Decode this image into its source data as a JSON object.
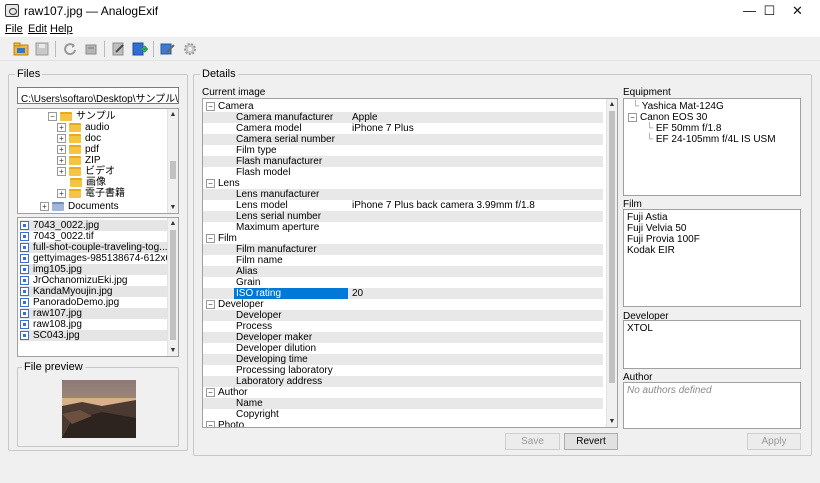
{
  "window": {
    "title": "raw107.jpg — AnalogExif",
    "minimize": "—",
    "maximize": "☐",
    "close": "✕"
  },
  "menu": {
    "file": "File",
    "edit": "Edit",
    "help": "Help"
  },
  "files": {
    "legend": "Files",
    "path": "C:\\Users\\softaro\\Desktop\\サンプル\\画像",
    "tree": [
      {
        "label": "サンプル",
        "expander": "⊟"
      },
      {
        "label": "audio",
        "expander": "⊞"
      },
      {
        "label": "doc",
        "expander": "⊞"
      },
      {
        "label": "pdf",
        "expander": "⊞"
      },
      {
        "label": "ZIP",
        "expander": "⊞"
      },
      {
        "label": "ビデオ",
        "expander": "⊞"
      },
      {
        "label": "画像",
        "expander": ""
      },
      {
        "label": "電子書籍",
        "expander": "⊞"
      },
      {
        "label": "Documents",
        "expander": "⊞"
      }
    ],
    "list": [
      "7043_0022.jpg",
      "7043_0022.tif",
      "full-shot-couple-traveling-tog...",
      "gettyimages-985138674-612x61...",
      "img105.jpg",
      "JrOchanomizuEki.jpg",
      "KandaMyoujin.jpg",
      "PanoradoDemo.jpg",
      "raw107.jpg",
      "raw108.jpg",
      "SC043.jpg"
    ],
    "preview_legend": "File preview"
  },
  "details": {
    "legend": "Details",
    "current_image_label": "Current image",
    "rows": [
      {
        "type": "cat",
        "name": "Camera"
      },
      {
        "type": "prop",
        "name": "Camera manufacturer",
        "value": "Apple"
      },
      {
        "type": "prop",
        "name": "Camera model",
        "value": "iPhone 7 Plus"
      },
      {
        "type": "prop",
        "name": "Camera serial number",
        "value": ""
      },
      {
        "type": "prop",
        "name": "Film type",
        "value": ""
      },
      {
        "type": "prop",
        "name": "Flash manufacturer",
        "value": ""
      },
      {
        "type": "prop",
        "name": "Flash model",
        "value": ""
      },
      {
        "type": "cat",
        "name": "Lens"
      },
      {
        "type": "prop",
        "name": "Lens manufacturer",
        "value": ""
      },
      {
        "type": "prop",
        "name": "Lens model",
        "value": "iPhone 7 Plus back camera 3.99mm f/1.8"
      },
      {
        "type": "prop",
        "name": "Lens serial number",
        "value": ""
      },
      {
        "type": "prop",
        "name": "Maximum aperture",
        "value": ""
      },
      {
        "type": "cat",
        "name": "Film"
      },
      {
        "type": "prop",
        "name": "Film manufacturer",
        "value": ""
      },
      {
        "type": "prop",
        "name": "Film name",
        "value": ""
      },
      {
        "type": "prop",
        "name": "Alias",
        "value": ""
      },
      {
        "type": "prop",
        "name": "Grain",
        "value": ""
      },
      {
        "type": "prop",
        "name": "ISO rating",
        "value": "20",
        "selected": true
      },
      {
        "type": "cat",
        "name": "Developer"
      },
      {
        "type": "prop",
        "name": "Developer",
        "value": ""
      },
      {
        "type": "prop",
        "name": "Process",
        "value": ""
      },
      {
        "type": "prop",
        "name": "Developer maker",
        "value": ""
      },
      {
        "type": "prop",
        "name": "Developer dilution",
        "value": ""
      },
      {
        "type": "prop",
        "name": "Developing time",
        "value": ""
      },
      {
        "type": "prop",
        "name": "Processing laboratory",
        "value": ""
      },
      {
        "type": "prop",
        "name": "Laboratory address",
        "value": ""
      },
      {
        "type": "cat",
        "name": "Author"
      },
      {
        "type": "prop",
        "name": "Name",
        "value": ""
      },
      {
        "type": "prop",
        "name": "Copyright",
        "value": ""
      },
      {
        "type": "cat",
        "name": "Photo"
      }
    ],
    "save": "Save",
    "revert": "Revert"
  },
  "equipment": {
    "label": "Equipment",
    "items": [
      {
        "label": "Yashica Mat-124G",
        "level": 0
      },
      {
        "label": "Canon EOS 30",
        "level": 0,
        "expander": "⊟"
      },
      {
        "label": "EF 50mm f/1.8",
        "level": 1
      },
      {
        "label": "EF 24-105mm f/4L IS USM",
        "level": 1
      }
    ]
  },
  "film": {
    "label": "Film",
    "items": [
      "Fuji Astia",
      "Fuji Velvia 50",
      "Fuji Provia 100F",
      "Kodak EIR"
    ]
  },
  "developer": {
    "label": "Developer",
    "items": [
      "XTOL"
    ]
  },
  "author": {
    "label": "Author",
    "empty": "No authors defined"
  },
  "apply": "Apply",
  "colors": {
    "selection": "#0078d7",
    "folder": "#f6c445"
  }
}
